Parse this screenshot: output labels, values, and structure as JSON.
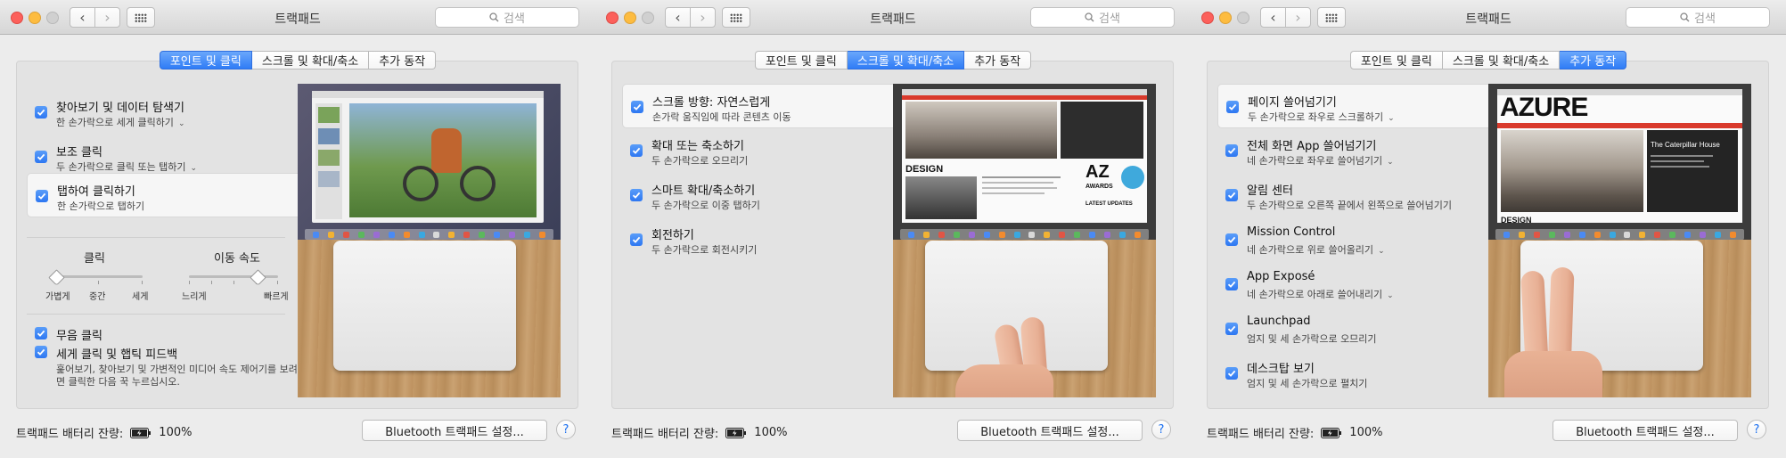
{
  "window_title": "트랙패드",
  "search_placeholder": "검색",
  "tabs": [
    "포인트 및 클릭",
    "스크롤 및 확대/축소",
    "추가 동작"
  ],
  "battery": {
    "label": "트랙패드 배터리 잔량:",
    "value": "100%"
  },
  "bt_button": "Bluetooth 트랙패드 설정...",
  "help": "?",
  "panel1": {
    "options": [
      {
        "title": "찾아보기 및 데이터 탐색기",
        "sub": "한 손가락으로 세게 클릭하기",
        "dropdown": true
      },
      {
        "title": "보조 클릭",
        "sub": "두 손가락으로 클릭 또는 탭하기",
        "dropdown": true
      },
      {
        "title": "탭하여 클릭하기",
        "sub": "한 손가락으로 탭하기",
        "dropdown": false
      }
    ],
    "click_slider": {
      "label": "클릭",
      "ticks": [
        "가볍게",
        "중간",
        "세게"
      ],
      "value": 0
    },
    "speed_slider": {
      "label": "이동 속도",
      "ticks": [
        "느리게",
        "빠르게"
      ],
      "value": 0.7
    },
    "bottom_options": [
      {
        "title": "무음 클릭"
      },
      {
        "title": "세게 클릭 및 햅틱 피드백",
        "desc1": "훑어보기, 찾아보기 및 가변적인 미디어 속도 제어기를 보려",
        "desc2": "면 클릭한 다음 꾹 누르십시오."
      }
    ]
  },
  "panel2": {
    "options": [
      {
        "title": "스크롤 방향: 자연스럽게",
        "sub": "손가락 움직임에 따라 콘텐츠 이동"
      },
      {
        "title": "확대 또는 축소하기",
        "sub": "두 손가락으로 오므리기"
      },
      {
        "title": "스마트 확대/축소하기",
        "sub": "두 손가락으로 이중 탭하기"
      },
      {
        "title": "회전하기",
        "sub": "두 손가락으로 회전시키기"
      }
    ],
    "screen_text": {
      "design": "DESIGN",
      "az": "AZ",
      "awards": "AWARDS",
      "updates": "LATEST UPDATES"
    }
  },
  "panel3": {
    "options": [
      {
        "title": "페이지 쓸어넘기기",
        "sub": "두 손가락으로 좌우로 스크롤하기",
        "dropdown": true
      },
      {
        "title": "전체 화면 App 쓸어넘기기",
        "sub": "네 손가락으로 좌우로 쓸어넘기기",
        "dropdown": true
      },
      {
        "title": "알림 센터",
        "sub": "두 손가락으로 오른쪽 끝에서 왼쪽으로 쓸어넘기기",
        "dropdown": false
      },
      {
        "title": "Mission Control",
        "sub": "네 손가락으로 위로 쓸어올리기",
        "dropdown": true
      },
      {
        "title": "App Exposé",
        "sub": "네 손가락으로 아래로 쓸어내리기",
        "dropdown": true
      },
      {
        "title": "Launchpad",
        "sub": "엄지 및 세 손가락으로 오므리기",
        "dropdown": false
      },
      {
        "title": "데스크탑 보기",
        "sub": "엄지 및 세 손가락으로 펼치기",
        "dropdown": false
      }
    ],
    "screen_text": {
      "brand": "AZURE",
      "headline": "The Caterpillar House",
      "design": "DESIGN"
    }
  }
}
